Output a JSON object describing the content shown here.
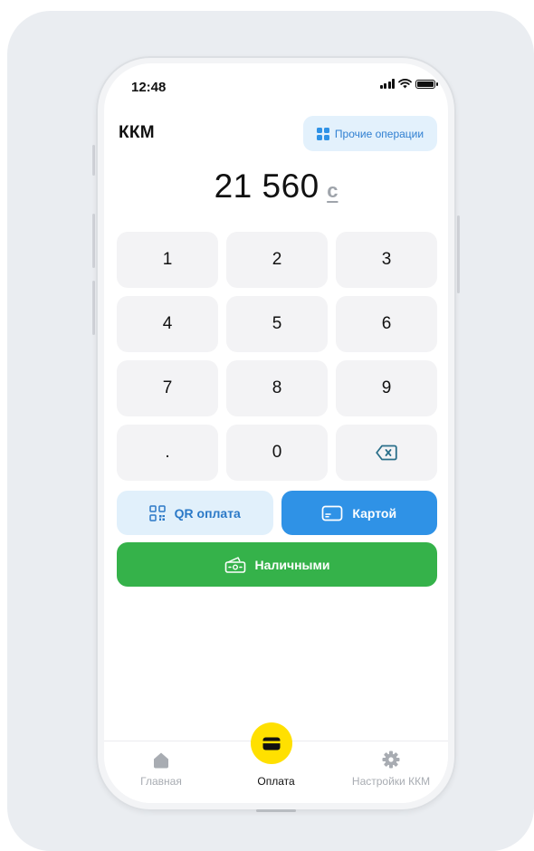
{
  "status_bar": {
    "time": "12:48"
  },
  "header": {
    "title": "ККМ",
    "other_operations_label": "Прочие операции"
  },
  "amount": {
    "value": "21 560",
    "currency": "с"
  },
  "keypad": {
    "keys": [
      "1",
      "2",
      "3",
      "4",
      "5",
      "6",
      "7",
      "8",
      "9",
      ".",
      "0"
    ],
    "backspace_icon": "backspace-icon"
  },
  "payment": {
    "qr_label": "QR оплата",
    "card_label": "Картой",
    "cash_label": "Наличными"
  },
  "tabbar": {
    "home_label": "Главная",
    "pay_label": "Оплата",
    "settings_label": "Настройки ККМ",
    "active": "Оплата"
  },
  "colors": {
    "accent_blue": "#2f92e6",
    "cash_green": "#35b24a",
    "fab_yellow": "#ffe000",
    "light_blue_bg": "#e1f0fb"
  }
}
